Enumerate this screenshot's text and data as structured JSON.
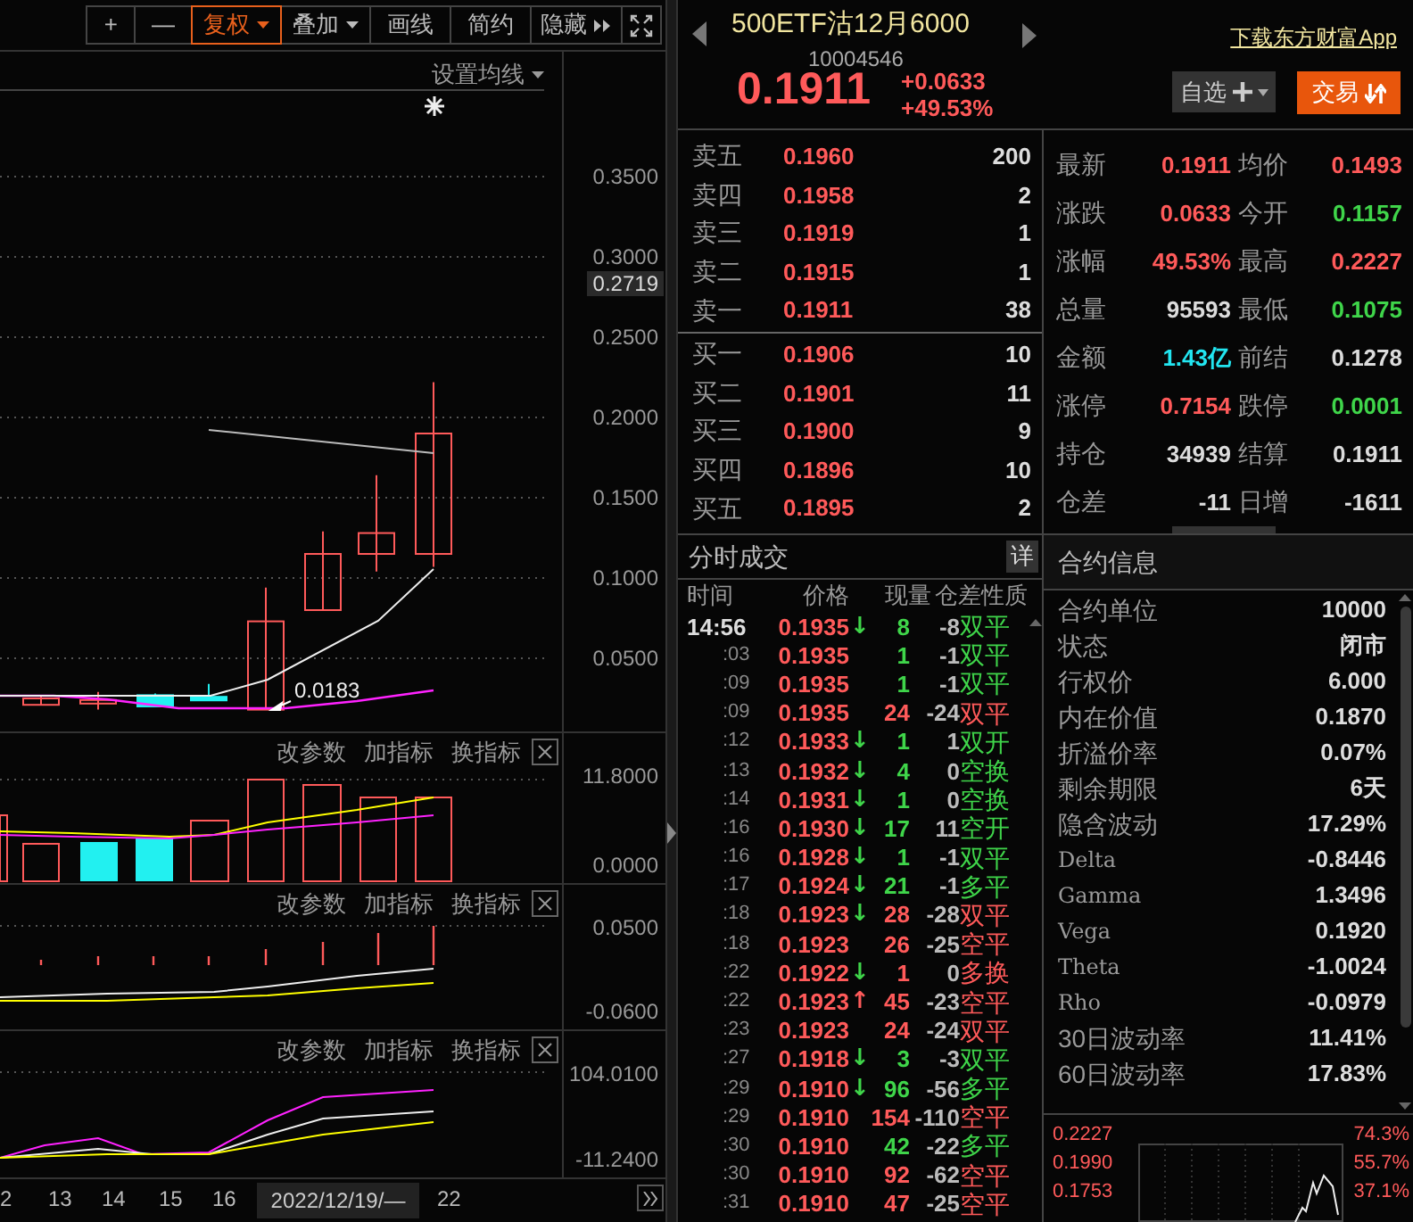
{
  "toolbar": {
    "buttons": [
      {
        "kind": "plain",
        "label": "+",
        "selected": false
      },
      {
        "kind": "plain",
        "label": "—",
        "selected": false
      },
      {
        "kind": "dropdown",
        "label": "复权",
        "selected": true
      },
      {
        "kind": "dropdown",
        "label": "叠加",
        "selected": false
      },
      {
        "kind": "plain",
        "label": "画线",
        "selected": false
      },
      {
        "kind": "plain",
        "label": "简约",
        "selected": false
      },
      {
        "kind": "collapse",
        "label": "隐藏",
        "selected": false
      },
      {
        "kind": "fullscreen",
        "selected": false
      }
    ]
  },
  "main_chart": {
    "ma_setting": "设置均线",
    "y_axis": [
      "0.3500",
      "0.3000",
      "0.2500",
      "0.2000",
      "0.1500",
      "0.1000",
      "0.0500"
    ],
    "price_tag": "0.2719",
    "low_label": "0.0183"
  },
  "indicator_panes": [
    {
      "controls": [
        "改参数",
        "加指标",
        "换指标"
      ],
      "y_axis": [
        "11.8000",
        "0.0000"
      ]
    },
    {
      "controls": [
        "改参数",
        "加指标",
        "换指标"
      ],
      "y_axis": [
        "0.0500",
        "-0.0600"
      ]
    },
    {
      "controls": [
        "改参数",
        "加指标",
        "换指标"
      ],
      "y_axis": [
        "104.0100",
        "-11.2400"
      ]
    }
  ],
  "date_axis": {
    "labels": [
      "2",
      "13",
      "14",
      "15",
      "16"
    ],
    "cursor_date": "2022/12/19/—",
    "end_label": "22"
  },
  "quote": {
    "name": "500ETF沽12月6000",
    "code": "10004546",
    "price": "0.1911",
    "change": "+0.0633",
    "change_pct": "+49.53%",
    "app_link": "下载东方财富App",
    "watch_button": "自选",
    "trade_button": "交易"
  },
  "order_book": {
    "asks": [
      {
        "label": "卖五",
        "price": "0.1960",
        "volume": "200"
      },
      {
        "label": "卖四",
        "price": "0.1958",
        "volume": "2"
      },
      {
        "label": "卖三",
        "price": "0.1919",
        "volume": "1"
      },
      {
        "label": "卖二",
        "price": "0.1915",
        "volume": "1"
      },
      {
        "label": "卖一",
        "price": "0.1911",
        "volume": "38"
      }
    ],
    "bids": [
      {
        "label": "买一",
        "price": "0.1906",
        "volume": "10"
      },
      {
        "label": "买二",
        "price": "0.1901",
        "volume": "11"
      },
      {
        "label": "买三",
        "price": "0.1900",
        "volume": "9"
      },
      {
        "label": "买四",
        "price": "0.1896",
        "volume": "10"
      },
      {
        "label": "买五",
        "price": "0.1895",
        "volume": "2"
      }
    ]
  },
  "stats": [
    {
      "label": "最新",
      "value": "0.1911",
      "color": "#ff5a5a"
    },
    {
      "label": "均价",
      "value": "0.1493",
      "color": "#ff5a5a"
    },
    {
      "label": "涨跌",
      "value": "0.0633",
      "color": "#ff5a5a"
    },
    {
      "label": "今开",
      "value": "0.1157",
      "color": "#3fd54a"
    },
    {
      "label": "涨幅",
      "value": "49.53%",
      "color": "#ff5a5a"
    },
    {
      "label": "最高",
      "value": "0.2227",
      "color": "#ff5a5a"
    },
    {
      "label": "总量",
      "value": "95593",
      "color": "#dcdcdc"
    },
    {
      "label": "最低",
      "value": "0.1075",
      "color": "#3fd54a"
    },
    {
      "label": "金额",
      "value": "1.43亿",
      "color": "#22e5f0"
    },
    {
      "label": "前结",
      "value": "0.1278",
      "color": "#dcdcdc"
    },
    {
      "label": "涨停",
      "value": "0.7154",
      "color": "#ff5a5a"
    },
    {
      "label": "跌停",
      "value": "0.0001",
      "color": "#3fd54a"
    },
    {
      "label": "持仓",
      "value": "34939",
      "color": "#dcdcdc"
    },
    {
      "label": "结算",
      "value": "0.1911",
      "color": "#dcdcdc"
    },
    {
      "label": "仓差",
      "value": "-11",
      "color": "#dcdcdc"
    },
    {
      "label": "日增",
      "value": "-1611",
      "color": "#dcdcdc"
    }
  ],
  "trades": {
    "title": "分时成交",
    "detail_button": "详",
    "columns": [
      "时间",
      "价格",
      "现量",
      "仓差",
      "性质"
    ],
    "rows": [
      {
        "time": "14:56",
        "full_time": true,
        "price": "0.1935",
        "arrow": {
          "glyph": "↓",
          "color": "#3fd54a"
        },
        "volume": "8",
        "change": "-8",
        "type": "双平",
        "color": "#3fd54a"
      },
      {
        "time": ":03",
        "full_time": false,
        "price": "0.1935",
        "volume": "1",
        "change": "-1",
        "type": "双平",
        "color": "#3fd54a"
      },
      {
        "time": ":09",
        "full_time": false,
        "price": "0.1935",
        "volume": "1",
        "change": "-1",
        "type": "双平",
        "color": "#3fd54a"
      },
      {
        "time": ":09",
        "full_time": false,
        "price": "0.1935",
        "volume": "24",
        "change": "-24",
        "type": "双平",
        "color": "#ff5a5a"
      },
      {
        "time": ":12",
        "full_time": false,
        "price": "0.1933",
        "arrow": {
          "glyph": "↓",
          "color": "#3fd54a"
        },
        "volume": "1",
        "change": "1",
        "type": "双开",
        "color": "#3fd54a"
      },
      {
        "time": ":13",
        "full_time": false,
        "price": "0.1932",
        "arrow": {
          "glyph": "↓",
          "color": "#3fd54a"
        },
        "volume": "4",
        "change": "0",
        "type": "空换",
        "color": "#3fd54a"
      },
      {
        "time": ":14",
        "full_time": false,
        "price": "0.1931",
        "arrow": {
          "glyph": "↓",
          "color": "#3fd54a"
        },
        "volume": "1",
        "change": "0",
        "type": "空换",
        "color": "#3fd54a"
      },
      {
        "time": ":16",
        "full_time": false,
        "price": "0.1930",
        "arrow": {
          "glyph": "↓",
          "color": "#3fd54a"
        },
        "volume": "17",
        "change": "11",
        "type": "空开",
        "color": "#3fd54a"
      },
      {
        "time": ":16",
        "full_time": false,
        "price": "0.1928",
        "arrow": {
          "glyph": "↓",
          "color": "#3fd54a"
        },
        "volume": "1",
        "change": "-1",
        "type": "双平",
        "color": "#3fd54a"
      },
      {
        "time": ":17",
        "full_time": false,
        "price": "0.1924",
        "arrow": {
          "glyph": "↓",
          "color": "#3fd54a"
        },
        "volume": "21",
        "change": "-1",
        "type": "多平",
        "color": "#3fd54a"
      },
      {
        "time": ":18",
        "full_time": false,
        "price": "0.1923",
        "arrow": {
          "glyph": "↓",
          "color": "#3fd54a"
        },
        "volume": "28",
        "change": "-28",
        "type": "双平",
        "color": "#ff5a5a"
      },
      {
        "time": ":18",
        "full_time": false,
        "price": "0.1923",
        "volume": "26",
        "change": "-25",
        "type": "空平",
        "color": "#ff5a5a"
      },
      {
        "time": ":22",
        "full_time": false,
        "price": "0.1922",
        "arrow": {
          "glyph": "↓",
          "color": "#3fd54a"
        },
        "volume": "1",
        "change": "0",
        "type": "多换",
        "color": "#ff5a5a"
      },
      {
        "time": ":22",
        "full_time": false,
        "price": "0.1923",
        "arrow": {
          "glyph": "↑",
          "color": "#ff5a5a"
        },
        "volume": "45",
        "change": "-23",
        "type": "空平",
        "color": "#ff5a5a"
      },
      {
        "time": ":23",
        "full_time": false,
        "price": "0.1923",
        "volume": "24",
        "change": "-24",
        "type": "双平",
        "color": "#ff5a5a"
      },
      {
        "time": ":27",
        "full_time": false,
        "price": "0.1918",
        "arrow": {
          "glyph": "↓",
          "color": "#3fd54a"
        },
        "volume": "3",
        "change": "-3",
        "type": "双平",
        "color": "#3fd54a"
      },
      {
        "time": ":29",
        "full_time": false,
        "price": "0.1910",
        "arrow": {
          "glyph": "↓",
          "color": "#3fd54a"
        },
        "volume": "96",
        "change": "-56",
        "type": "多平",
        "color": "#3fd54a"
      },
      {
        "time": ":29",
        "full_time": false,
        "price": "0.1910",
        "volume": "154",
        "change": "-110",
        "type": "空平",
        "color": "#ff5a5a"
      },
      {
        "time": ":30",
        "full_time": false,
        "price": "0.1910",
        "volume": "42",
        "change": "-22",
        "type": "多平",
        "color": "#3fd54a"
      },
      {
        "time": ":30",
        "full_time": false,
        "price": "0.1910",
        "volume": "92",
        "change": "-62",
        "type": "空平",
        "color": "#ff5a5a"
      },
      {
        "time": ":31",
        "full_time": false,
        "price": "0.1910",
        "volume": "47",
        "change": "-25",
        "type": "空平",
        "color": "#ff5a5a"
      }
    ]
  },
  "contract": {
    "title": "合约信息",
    "rows": [
      {
        "kind": "text",
        "label": "合约单位",
        "value": "10000"
      },
      {
        "kind": "text",
        "label": "状态",
        "value": "闭市"
      },
      {
        "kind": "text",
        "label": "行权价",
        "value": "6.000"
      },
      {
        "kind": "text",
        "label": "内在价值",
        "value": "0.1870"
      },
      {
        "kind": "text",
        "label": "折溢价率",
        "value": "0.07%"
      },
      {
        "kind": "text",
        "label": "剩余期限",
        "value": "6天"
      },
      {
        "kind": "text",
        "label": "隐含波动",
        "value": "17.29%"
      },
      {
        "kind": "greek",
        "label": "Delta",
        "value": "-0.8446"
      },
      {
        "kind": "greek",
        "label": "Gamma",
        "value": "1.3496"
      },
      {
        "kind": "greek",
        "label": "Vega",
        "value": "0.1920"
      },
      {
        "kind": "greek",
        "label": "Theta",
        "value": "-1.0024"
      },
      {
        "kind": "greek",
        "label": "Rho",
        "value": "-0.0979"
      },
      {
        "kind": "text",
        "label": "30日波动率",
        "value": "11.41%"
      },
      {
        "kind": "text",
        "label": "60日波动率",
        "value": "17.83%"
      }
    ]
  },
  "mini_chart": {
    "left_labels": [
      "0.2227",
      "0.1990",
      "0.1753"
    ],
    "right_labels": [
      "74.3%",
      "55.7%",
      "37.1%"
    ]
  }
}
